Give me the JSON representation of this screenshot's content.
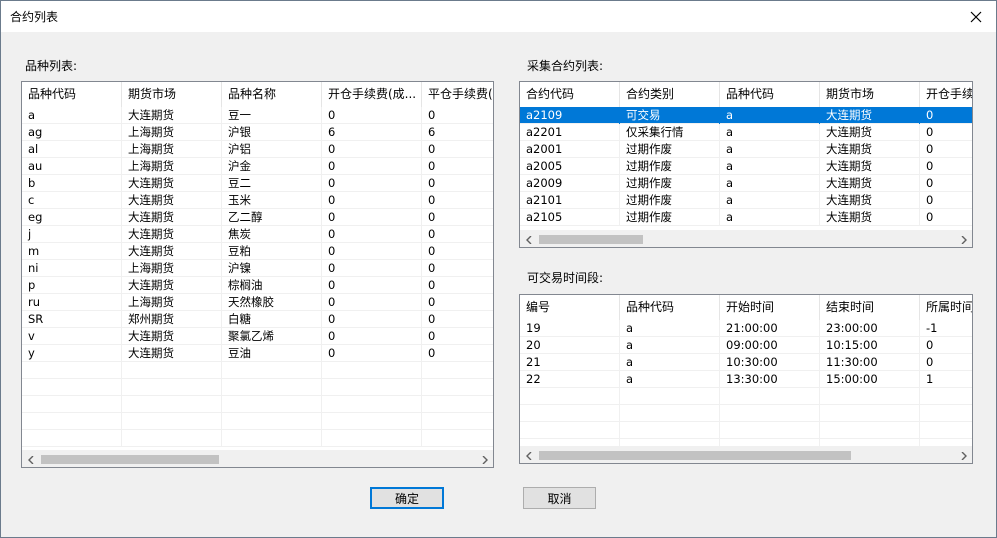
{
  "window": {
    "title": "合约列表"
  },
  "left": {
    "label": "品种列表:",
    "columns": [
      "品种代码",
      "期货市场",
      "品种名称",
      "开仓手续费(成...",
      "平仓手续费("
    ],
    "rows": [
      [
        "a",
        "大连期货",
        "豆一",
        "0",
        "0"
      ],
      [
        "ag",
        "上海期货",
        "沪银",
        "6",
        "6"
      ],
      [
        "al",
        "上海期货",
        "沪铝",
        "0",
        "0"
      ],
      [
        "au",
        "上海期货",
        "沪金",
        "0",
        "0"
      ],
      [
        "b",
        "大连期货",
        "豆二",
        "0",
        "0"
      ],
      [
        "c",
        "大连期货",
        "玉米",
        "0",
        "0"
      ],
      [
        "eg",
        "大连期货",
        "乙二醇",
        "0",
        "0"
      ],
      [
        "j",
        "大连期货",
        "焦炭",
        "0",
        "0"
      ],
      [
        "m",
        "大连期货",
        "豆粕",
        "0",
        "0"
      ],
      [
        "ni",
        "上海期货",
        "沪镍",
        "0",
        "0"
      ],
      [
        "p",
        "大连期货",
        "棕榈油",
        "0",
        "0"
      ],
      [
        "ru",
        "上海期货",
        "天然橡胶",
        "0",
        "0"
      ],
      [
        "SR",
        "郑州期货",
        "白糖",
        "0",
        "0"
      ],
      [
        "v",
        "大连期货",
        "聚氯乙烯",
        "0",
        "0"
      ],
      [
        "y",
        "大连期货",
        "豆油",
        "0",
        "0"
      ],
      [
        "",
        "",
        "",
        "",
        ""
      ],
      [
        "",
        "",
        "",
        "",
        ""
      ],
      [
        "",
        "",
        "",
        "",
        ""
      ],
      [
        "",
        "",
        "",
        "",
        ""
      ],
      [
        "",
        "",
        "",
        "",
        ""
      ]
    ]
  },
  "contracts": {
    "label": "采集合约列表:",
    "columns": [
      "合约代码",
      "合约类别",
      "品种代码",
      "期货市场",
      "开仓手续"
    ],
    "rows": [
      [
        "a2109",
        "可交易",
        "a",
        "大连期货",
        "0"
      ],
      [
        "a2201",
        "仅采集行情",
        "a",
        "大连期货",
        "0"
      ],
      [
        "a2001",
        "过期作废",
        "a",
        "大连期货",
        "0"
      ],
      [
        "a2005",
        "过期作废",
        "a",
        "大连期货",
        "0"
      ],
      [
        "a2009",
        "过期作废",
        "a",
        "大连期货",
        "0"
      ],
      [
        "a2101",
        "过期作废",
        "a",
        "大连期货",
        "0"
      ],
      [
        "a2105",
        "过期作废",
        "a",
        "大连期货",
        "0"
      ]
    ],
    "selected_index": 0
  },
  "periods": {
    "label": "可交易时间段:",
    "columns": [
      "编号",
      "品种代码",
      "开始时间",
      "结束时间",
      "所属时间"
    ],
    "rows": [
      [
        "19",
        "a",
        "21:00:00",
        "23:00:00",
        "-1"
      ],
      [
        "20",
        "a",
        "09:00:00",
        "10:15:00",
        "0"
      ],
      [
        "21",
        "a",
        "10:30:00",
        "11:30:00",
        "0"
      ],
      [
        "22",
        "a",
        "13:30:00",
        "15:00:00",
        "1"
      ],
      [
        "",
        "",
        "",
        "",
        ""
      ],
      [
        "",
        "",
        "",
        "",
        ""
      ],
      [
        "",
        "",
        "",
        "",
        ""
      ],
      [
        "",
        "",
        "",
        "",
        ""
      ]
    ]
  },
  "buttons": {
    "ok": "确定",
    "cancel": "取消"
  },
  "colors": {
    "selection": "#0078d7",
    "accent": "#0078d7"
  },
  "icons": {
    "close": "close-icon",
    "scroll_left": "chevron-left-icon",
    "scroll_right": "chevron-right-icon"
  }
}
